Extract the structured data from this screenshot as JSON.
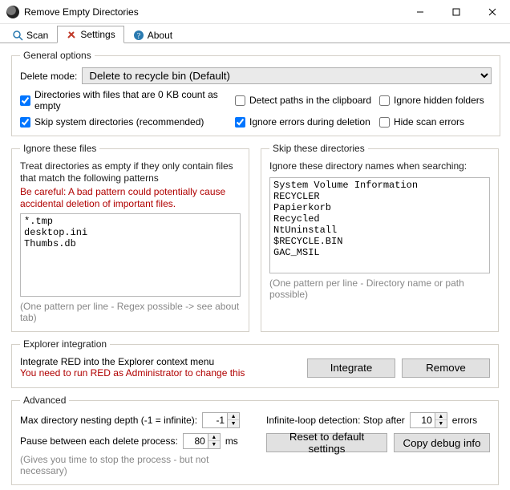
{
  "window": {
    "title": "Remove Empty Directories"
  },
  "tabs": {
    "scan": "Scan",
    "settings": "Settings",
    "about": "About",
    "active": "settings"
  },
  "general": {
    "legend": "General options",
    "delete_mode_label": "Delete mode:",
    "delete_mode_value": "Delete to recycle bin (Default)",
    "cb_zerokb": {
      "label": "Directories with files that are 0 KB count as empty",
      "checked": true
    },
    "cb_clipboard": {
      "label": "Detect paths in the clipboard",
      "checked": false
    },
    "cb_hidden": {
      "label": "Ignore hidden folders",
      "checked": false
    },
    "cb_skipsys": {
      "label": "Skip system directories (recommended)",
      "checked": true
    },
    "cb_ignerr": {
      "label": "Ignore errors during deletion",
      "checked": true
    },
    "cb_hideerr": {
      "label": "Hide scan errors",
      "checked": false
    }
  },
  "ignore_files": {
    "legend": "Ignore these files",
    "desc": "Treat directories as empty if they only contain files that match the following patterns",
    "warn": "Be careful: A bad pattern could potentially cause accidental deletion of important files.",
    "value": "*.tmp\ndesktop.ini\nThumbs.db",
    "hint": "(One pattern per line - Regex possible -> see about tab)"
  },
  "skip_dirs": {
    "legend": "Skip these directories",
    "desc": "Ignore these directory names when searching:",
    "value": "System Volume Information\nRECYCLER\nPapierkorb\nRecycled\nNtUninstall\n$RECYCLE.BIN\nGAC_MSIL",
    "hint": "(One pattern per line - Directory name or path possible)"
  },
  "explorer": {
    "legend": "Explorer integration",
    "desc": "Integrate RED into the Explorer context menu",
    "warn": "You need to run RED as Administrator to change this",
    "btn_integrate": "Integrate",
    "btn_remove": "Remove"
  },
  "advanced": {
    "legend": "Advanced",
    "max_depth_label": "Max directory nesting depth (-1 = infinite):",
    "max_depth_value": "-1",
    "pause_label": "Pause between each delete process:",
    "pause_value": "80",
    "pause_unit": "ms",
    "pause_note": "(Gives you time to stop the process - but not necessary)",
    "loop_label": "Infinite-loop detection: Stop after",
    "loop_value": "10",
    "loop_unit": "errors",
    "btn_reset": "Reset to default settings",
    "btn_copy": "Copy debug info"
  }
}
